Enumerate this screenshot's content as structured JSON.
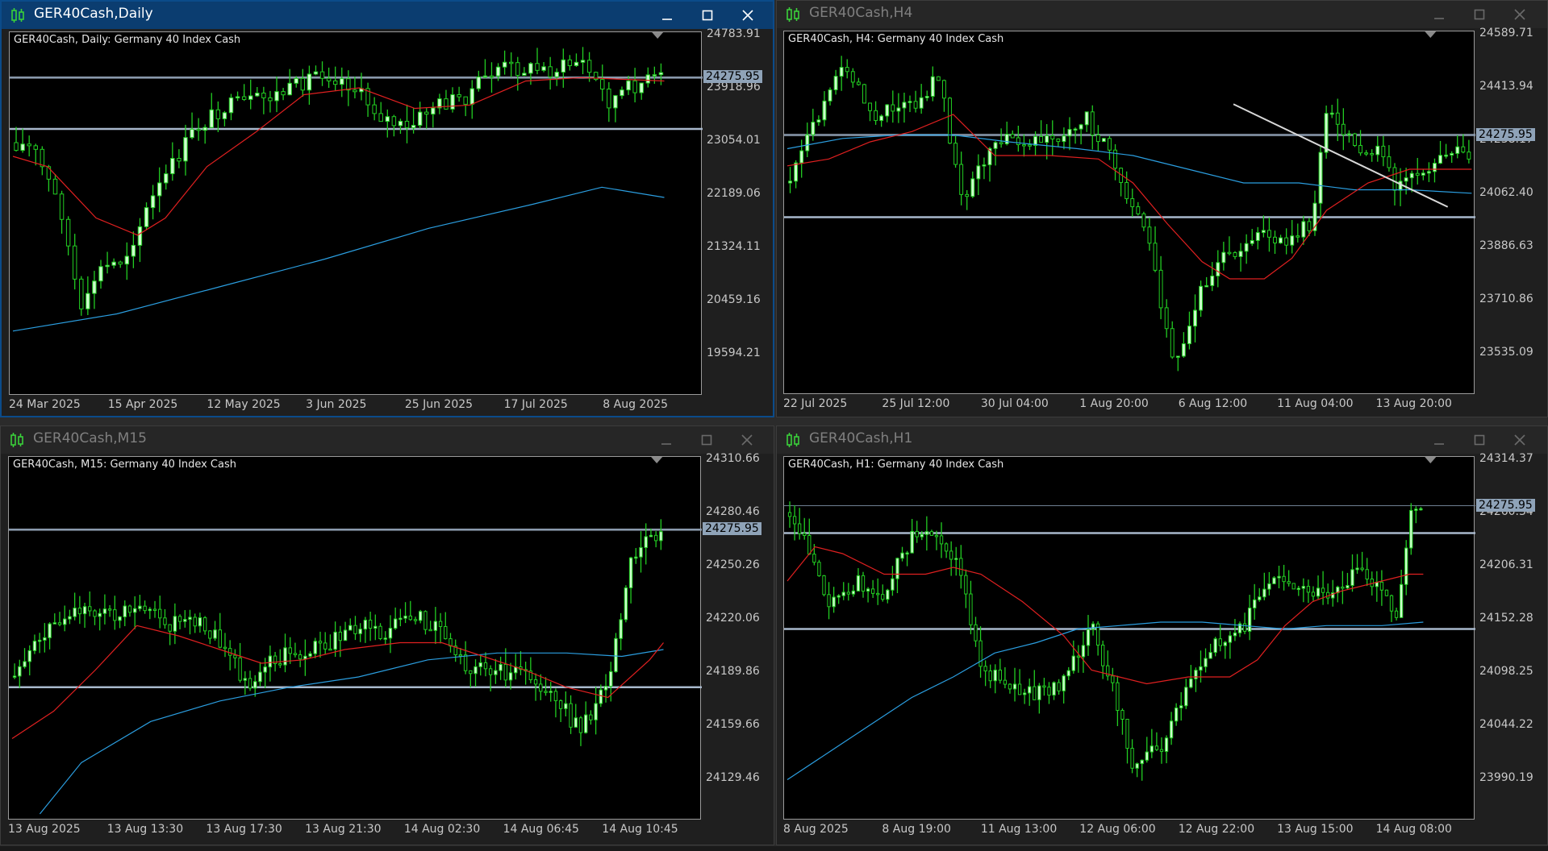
{
  "windows": [
    {
      "id": "daily",
      "title": "GER40Cash,Daily",
      "active": true,
      "label": "GER40Cash, Daily:  Germany 40 Index Cash",
      "price_ticks": [
        "24783.91",
        "23918.96",
        "23054.01",
        "22189.06",
        "21324.11",
        "20459.16",
        "19594.21"
      ],
      "current_price": "24275.95",
      "time_ticks": [
        "24 Mar 2025",
        "15 Apr 2025",
        "12 May 2025",
        "3 Jun 2025",
        "25 Jun 2025",
        "17 Jul 2025",
        "8 Aug 2025"
      ]
    },
    {
      "id": "h4",
      "title": "GER40Cash,H4",
      "active": false,
      "label": "GER40Cash, H4:  Germany 40 Index Cash",
      "price_ticks": [
        "24589.71",
        "24413.94",
        "24238.17",
        "24062.40",
        "23886.63",
        "23710.86",
        "23535.09"
      ],
      "current_price": "24275.95",
      "time_ticks": [
        "22 Jul 2025",
        "25 Jul 12:00",
        "30 Jul 04:00",
        "1 Aug 20:00",
        "6 Aug 12:00",
        "11 Aug 04:00",
        "13 Aug 20:00"
      ]
    },
    {
      "id": "m15",
      "title": "GER40Cash,M15",
      "active": false,
      "label": "GER40Cash, M15:  Germany 40 Index Cash",
      "price_ticks": [
        "24310.66",
        "24280.46",
        "24250.26",
        "24220.06",
        "24189.86",
        "24159.66",
        "24129.46"
      ],
      "current_price": "24275.95",
      "time_ticks": [
        "13 Aug 2025",
        "13 Aug 13:30",
        "13 Aug 17:30",
        "13 Aug 21:30",
        "14 Aug 02:30",
        "14 Aug 06:45",
        "14 Aug 10:45"
      ]
    },
    {
      "id": "h1",
      "title": "GER40Cash,H1",
      "active": false,
      "label": "GER40Cash, H1:  Germany 40 Index Cash",
      "price_ticks": [
        "24314.37",
        "24260.34",
        "24206.31",
        "24152.28",
        "24098.25",
        "24044.22",
        "23990.19"
      ],
      "current_price": "24275.95",
      "time_ticks": [
        "8 Aug 2025",
        "8 Aug 19:00",
        "11 Aug 13:00",
        "12 Aug 06:00",
        "12 Aug 22:00",
        "13 Aug 15:00",
        "14 Aug 08:00"
      ]
    }
  ],
  "colors": {
    "bull_candle": "#ccffcc",
    "bear_candle": "#000000",
    "wick": "#22cc22",
    "ma_fast": "#e02020",
    "ma_slow": "#2b9ee0",
    "level_line": "#a8b8cc",
    "trend_line": "#d8d8d8"
  }
}
